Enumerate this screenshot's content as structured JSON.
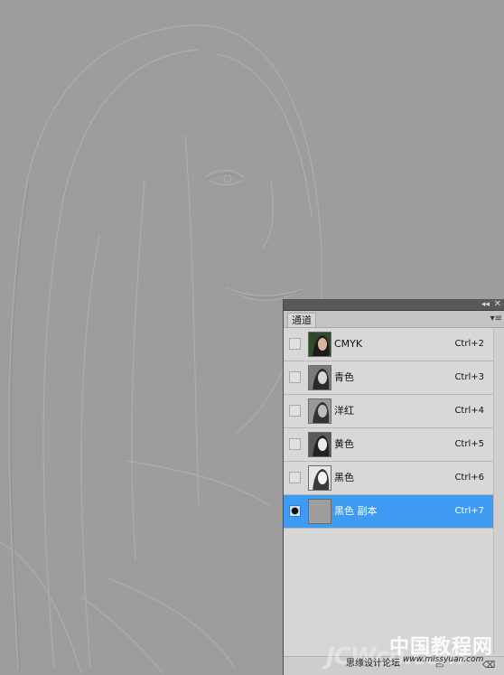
{
  "panel": {
    "tab_label": "通道",
    "collapse_glyph": "◂◂",
    "close_glyph": "✕",
    "menu_glyph": "▾≡"
  },
  "channels": [
    {
      "label": "CMYK",
      "shortcut": "Ctrl+2",
      "visible": false,
      "selected": false
    },
    {
      "label": "青色",
      "shortcut": "Ctrl+3",
      "visible": false,
      "selected": false
    },
    {
      "label": "洋红",
      "shortcut": "Ctrl+4",
      "visible": false,
      "selected": false
    },
    {
      "label": "黄色",
      "shortcut": "Ctrl+5",
      "visible": false,
      "selected": false
    },
    {
      "label": "黑色",
      "shortcut": "Ctrl+6",
      "visible": false,
      "selected": false
    },
    {
      "label": "黑色 副本",
      "shortcut": "Ctrl+7",
      "visible": true,
      "selected": true
    }
  ],
  "icons": {
    "eye": "eye-icon"
  },
  "colors": {
    "selected_row": "#3f9bf2",
    "panel_bg": "#d6d6d6",
    "canvas_bg": "#9d9d9d"
  },
  "watermark": {
    "cn": "中国教程网",
    "logo": "JCWcn.com",
    "site": "思缘设计论坛",
    "url": "www.missyuan.com"
  }
}
